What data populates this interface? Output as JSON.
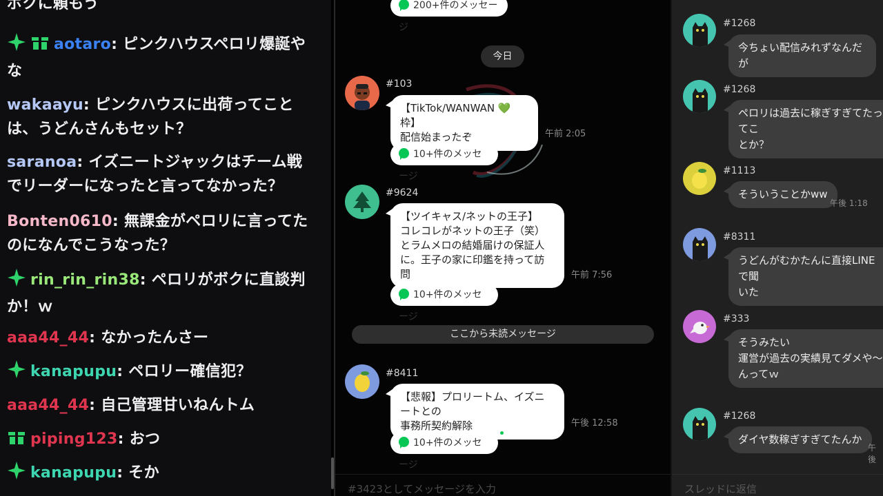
{
  "stream_chat": {
    "messages": [
      {
        "badges": [],
        "user": "",
        "user_color": "#efeff1",
        "text": "ボクに頼もう"
      },
      {
        "badges": [
          "sparkle-badge",
          "gift-badge"
        ],
        "user": "aotaro",
        "user_color": "#3b82f6",
        "text": "ピンクハウスペロリ爆誕や\nな"
      },
      {
        "badges": [],
        "user": "wakaayu",
        "user_color": "#b5c8f5",
        "text": "ピンクハウスに出荷ってこと\nは、うどんさんもセット？"
      },
      {
        "badges": [],
        "user": "saranoa",
        "user_color": "#b5c8f5",
        "text": "イズニートジャックはチーム戦\nでリーダーになったと言ってなかった？"
      },
      {
        "badges": [],
        "user": "Bonten0610",
        "user_color": "#f5b8c8",
        "text": "無課金がペロリに言ってた\nのになんでこうなった？"
      },
      {
        "badges": [
          "sparkle-badge"
        ],
        "user": "rin_rin_rin38",
        "user_color": "#9be87a",
        "text": "ペロリがボクに直談判\nか！ｗ"
      },
      {
        "badges": [],
        "user": "aaa44_44",
        "user_color": "#e0354f",
        "text": "なかったんさー"
      },
      {
        "badges": [
          "sparkle-badge"
        ],
        "user": "kanapupu",
        "user_color": "#3dd6b0",
        "text": "ペロリー確信犯？"
      },
      {
        "badges": [],
        "user": "aaa44_44",
        "user_color": "#e0354f",
        "text": "自己管理甘いねんトム"
      },
      {
        "badges": [
          "gift-badge"
        ],
        "user": "piping123",
        "user_color": "#e0354f",
        "text": "おつ"
      },
      {
        "badges": [
          "sparkle-badge"
        ],
        "user": "kanapupu",
        "user_color": "#3dd6b0",
        "text": "そか"
      }
    ]
  },
  "openchat": {
    "top_thread_label": "200+件のメッセージ",
    "day_separator": "今日",
    "posts": [
      {
        "id": "#103",
        "avatar": "man-avatar-icon",
        "text": "【TikTok/WANWAN 💚 枠】\n配信始まったぞ",
        "time": "午前 2:05",
        "thread": "10+件のメッセージ"
      },
      {
        "id": "#9624",
        "avatar": "tree-avatar-icon",
        "text": "【ツイキャス/ネットの王子】\nコレコレがネットの王子（笑）\nとラムメロの結婚届けの保証人\nに。王子の家に印鑑を持って訪問",
        "time": "午前 7:56",
        "thread": "10+件のメッセージ"
      },
      {
        "id": "#8411",
        "avatar": "lemon-avatar-icon",
        "text": "【悲報】プロリートム、イズニートとの\n事務所契約解除",
        "time": "午後 12:58",
        "thread": "10+件のメッセージ"
      }
    ],
    "unread_separator": "ここから未読メッセージ",
    "input_placeholder": "#3423としてメッセージを入力"
  },
  "thread": {
    "replies": [
      {
        "id": "#1268",
        "avatar": "cat-avatar-icon",
        "text": "今ちょい配信みれずなんだが",
        "time": ""
      },
      {
        "id": "#1268",
        "avatar": "cat-avatar-icon",
        "text": "ペロリは過去に稼ぎすぎてたってこ\nとか？",
        "time": ""
      },
      {
        "id": "#1113",
        "avatar": "lemon-avatar-icon",
        "text": "そういうことかww",
        "time": "午後 1:18"
      },
      {
        "id": "#8311",
        "avatar": "cat-avatar-icon",
        "text": "うどんがむかたんに直接LINEで聞\nいた",
        "time": ""
      },
      {
        "id": "#333",
        "avatar": "bird-avatar-icon",
        "text": "そうみたい\n運営が過去の実績見てダメや〜\nんってｗ",
        "time": ""
      },
      {
        "id": "#1268",
        "avatar": "cat-avatar-icon",
        "text": "ダイヤ数稼ぎすぎてたんか",
        "time": "午後"
      }
    ],
    "input_placeholder": "スレッドに返信"
  }
}
